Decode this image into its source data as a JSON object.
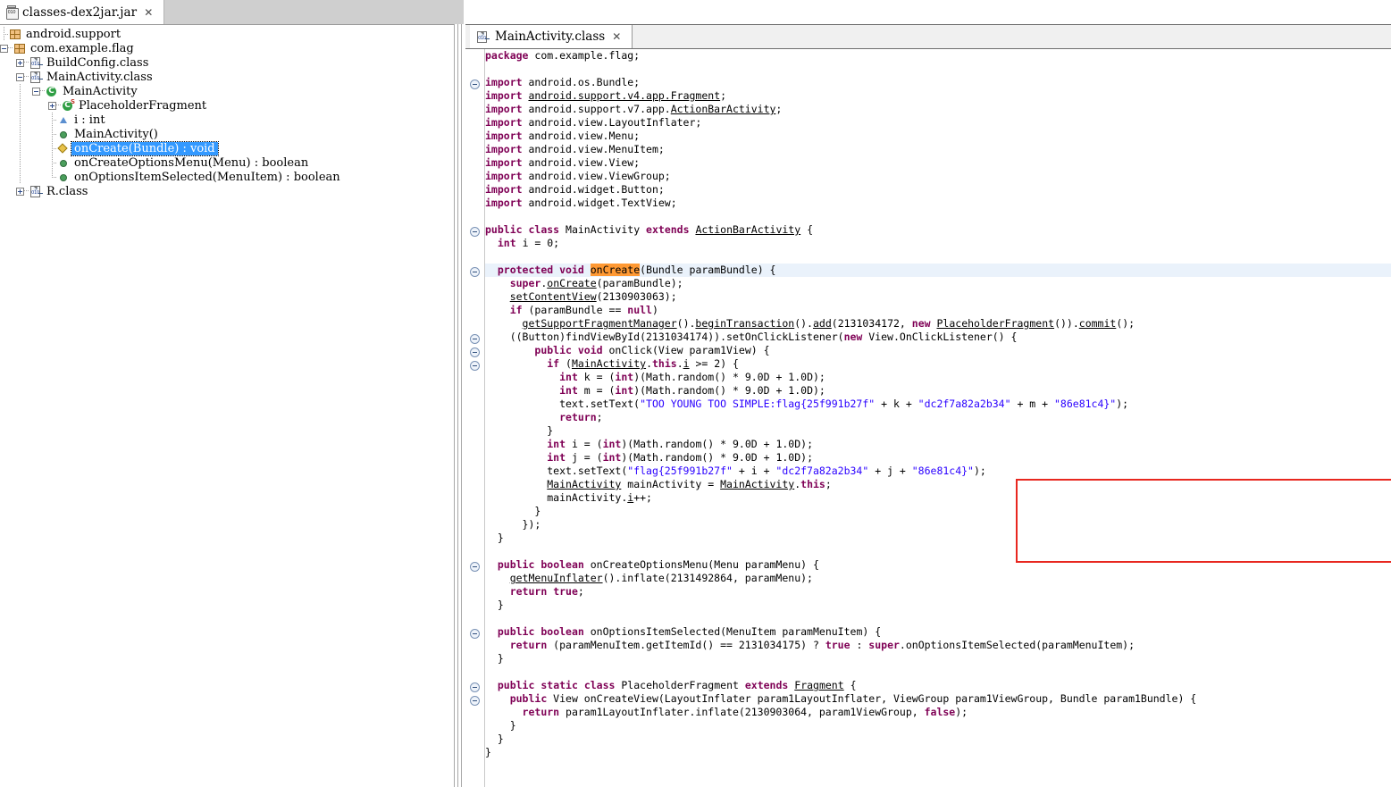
{
  "window": {
    "jar_tab": {
      "title": "classes-dex2jar.jar",
      "close": "✕",
      "icon": "jar-icon",
      "icon_label": "010"
    }
  },
  "sidebar": {
    "tree": [
      {
        "depth": 0,
        "expander": "none",
        "icon": "package-icon",
        "label": "android.support"
      },
      {
        "depth": 0,
        "expander": "minus",
        "icon": "package-icon",
        "label": "com.example.flag"
      },
      {
        "depth": 1,
        "expander": "plus",
        "icon": "class-file-icon",
        "label": "BuildConfig.class"
      },
      {
        "depth": 1,
        "expander": "minus",
        "icon": "class-file-icon",
        "label": "MainActivity.class"
      },
      {
        "depth": 2,
        "expander": "minus",
        "icon": "class-icon",
        "label": "MainActivity"
      },
      {
        "depth": 3,
        "expander": "plus",
        "icon": "static-class-icon",
        "label": "PlaceholderFragment"
      },
      {
        "depth": 3,
        "expander": "none",
        "icon": "field-icon",
        "label": "i : int"
      },
      {
        "depth": 3,
        "expander": "none",
        "icon": "method-icon",
        "label": "MainActivity()"
      },
      {
        "depth": 3,
        "expander": "none",
        "icon": "protected-method-icon",
        "label": "onCreate(Bundle) : void",
        "selected": true
      },
      {
        "depth": 3,
        "expander": "none",
        "icon": "method-icon",
        "label": "onCreateOptionsMenu(Menu) : boolean"
      },
      {
        "depth": 3,
        "expander": "none",
        "icon": "method-icon",
        "label": "onOptionsItemSelected(MenuItem) : boolean"
      },
      {
        "depth": 1,
        "expander": "plus",
        "icon": "class-file-icon",
        "label": "R.class"
      }
    ]
  },
  "editor": {
    "tab": {
      "title": "MainActivity.class",
      "close": "✕",
      "icon": "class-file-icon",
      "icon_label": "010"
    },
    "highlight_word": "onCreate",
    "colors": {
      "keyword": "#7F0055",
      "string": "#2A00FF",
      "occurrence_highlight": "#FF9933",
      "current_line": "#EAF2FB",
      "selection": "#3399FF",
      "annotation_box": "#E8271F"
    },
    "fold_markers_lines": [
      1,
      8,
      15,
      19,
      20,
      21,
      36,
      41,
      45,
      46
    ],
    "code_lines": [
      "package com.example.flag;",
      "",
      "import android.os.Bundle;",
      "import android.support.v4.app.Fragment;",
      "import android.support.v7.app.ActionBarActivity;",
      "import android.view.LayoutInflater;",
      "import android.view.Menu;",
      "import android.view.MenuItem;",
      "import android.view.View;",
      "import android.view.ViewGroup;",
      "import android.widget.Button;",
      "import android.widget.TextView;",
      "",
      "public class MainActivity extends ActionBarActivity {",
      "  int i = 0;",
      "",
      "  protected void onCreate(Bundle paramBundle) {",
      "    super.onCreate(paramBundle);",
      "    setContentView(2130903063);",
      "    if (paramBundle == null)",
      "      getSupportFragmentManager().beginTransaction().add(2131034172, new PlaceholderFragment()).commit();",
      "    ((Button)findViewById(2131034174)).setOnClickListener(new View.OnClickListener() {",
      "        public void onClick(View param1View) {",
      "          if (MainActivity.this.i >= 2) {",
      "            int k = (int)(Math.random() * 9.0D + 1.0D);",
      "            int m = (int)(Math.random() * 9.0D + 1.0D);",
      "            text.setText(\"TOO YOUNG TOO SIMPLE:flag{25f991b27f\" + k + \"dc2f7a82a2b34\" + m + \"86e81c4}\");",
      "            return;",
      "          }",
      "          int i = (int)(Math.random() * 9.0D + 1.0D);",
      "          int j = (int)(Math.random() * 9.0D + 1.0D);",
      "          text.setText(\"flag{25f991b27f\" + i + \"dc2f7a82a2b34\" + j + \"86e81c4}\");",
      "          MainActivity mainActivity = MainActivity.this;",
      "          mainActivity.i++;",
      "        }",
      "      });",
      "  }",
      "",
      "  public boolean onCreateOptionsMenu(Menu paramMenu) {",
      "    getMenuInflater().inflate(2131492864, paramMenu);",
      "    return true;",
      "  }",
      "",
      "  public boolean onOptionsItemSelected(MenuItem paramMenuItem) {",
      "    return (paramMenuItem.getItemId() == 2131034175) ? true : super.onOptionsItemSelected(paramMenuItem);",
      "  }",
      "",
      "  public static class PlaceholderFragment extends Fragment {",
      "    public View onCreateView(LayoutInflater param1LayoutInflater, ViewGroup param1ViewGroup, Bundle param1Bundle) {",
      "      return param1LayoutInflater.inflate(2130903064, param1ViewGroup, false);",
      "    }",
      "  }",
      "}"
    ],
    "annotation": {
      "type": "red-rectangle",
      "covers_lines": [
        "}",
        "int i = (int)(Math.random() * 9.0D + 1.0D);",
        "int j = (int)(Math.random() * 9.0D + 1.0D);",
        "text.setText(\"flag{25f991b27f\" + i + \"dc2f7a82a2b34\" + j + \"86e81c4}\");",
        "MainActivity mainActivity = MainActivity.this;",
        "mainActivity.i++;"
      ]
    }
  }
}
